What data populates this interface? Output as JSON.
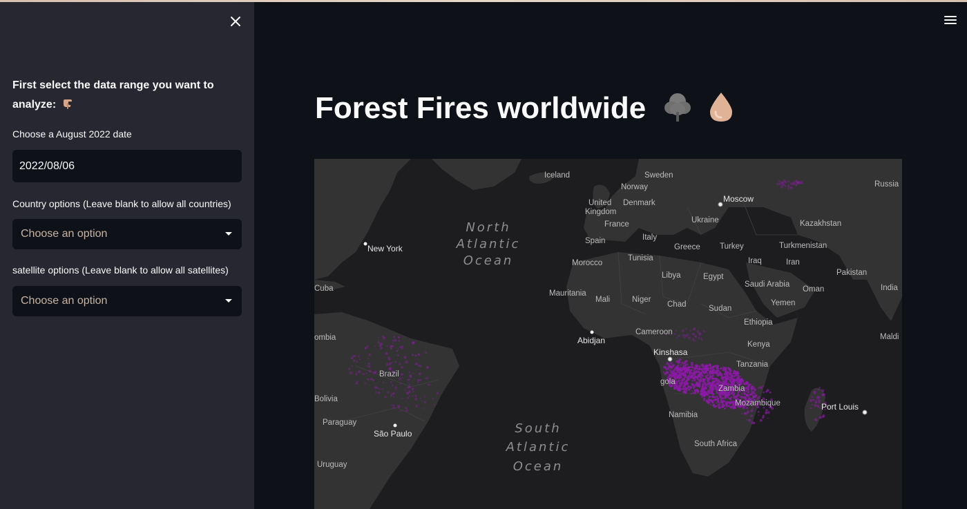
{
  "sidebar": {
    "heading": "First select the data range you want to analyze:",
    "heading_icon": "pointing-hand-icon",
    "date_label": "Choose a August 2022 date",
    "date_value": "2022/08/06",
    "country_label": "Country options (Leave blank to allow all countries)",
    "country_placeholder": "Choose an option",
    "satellite_label": "satellite options (Leave blank to allow all satellites)",
    "satellite_placeholder": "Choose an option"
  },
  "main": {
    "title": "Forest Fires worldwide",
    "title_icons": [
      "tree-icon",
      "droplet-icon"
    ]
  },
  "map": {
    "oceans": [
      [
        "North",
        "Atlantic",
        "Ocean"
      ],
      [
        "South",
        "Atlantic",
        "Ocean"
      ]
    ],
    "cities": [
      "New York",
      "Moscow",
      "Abidjan",
      "Kinshasa",
      "São Paulo",
      "Port Louis"
    ],
    "countries": [
      "Iceland",
      "Sweden",
      "Norway",
      "Russia",
      "United",
      "Kingdom",
      "Denmark",
      "France",
      "Ukraine",
      "Kazakhstan",
      "Spain",
      "Italy",
      "Greece",
      "Turkey",
      "Turkmenistan",
      "Morocco",
      "Tunisia",
      "Iraq",
      "Iran",
      "Libya",
      "Egypt",
      "Saudi Arabia",
      "Oman",
      "Pakistan",
      "India",
      "Cuba",
      "Mauritania",
      "Mali",
      "Niger",
      "Chad",
      "Sudan",
      "Yemen",
      "Ethiopia",
      "Cameroon",
      "Kenya",
      "Tanzania",
      "Maldi",
      "ombia",
      "Brazil",
      "Bolivia",
      "Paraguay",
      "Uruguay",
      "Namibia",
      "Mozambique",
      "South Africa",
      "Zambia",
      "gola"
    ],
    "fire_color": "#8b1aa6"
  },
  "colors": {
    "sidebar_bg": "#262730",
    "main_bg": "#0e1117",
    "text": "#fafafa",
    "placeholder": "#c8b4a4"
  }
}
